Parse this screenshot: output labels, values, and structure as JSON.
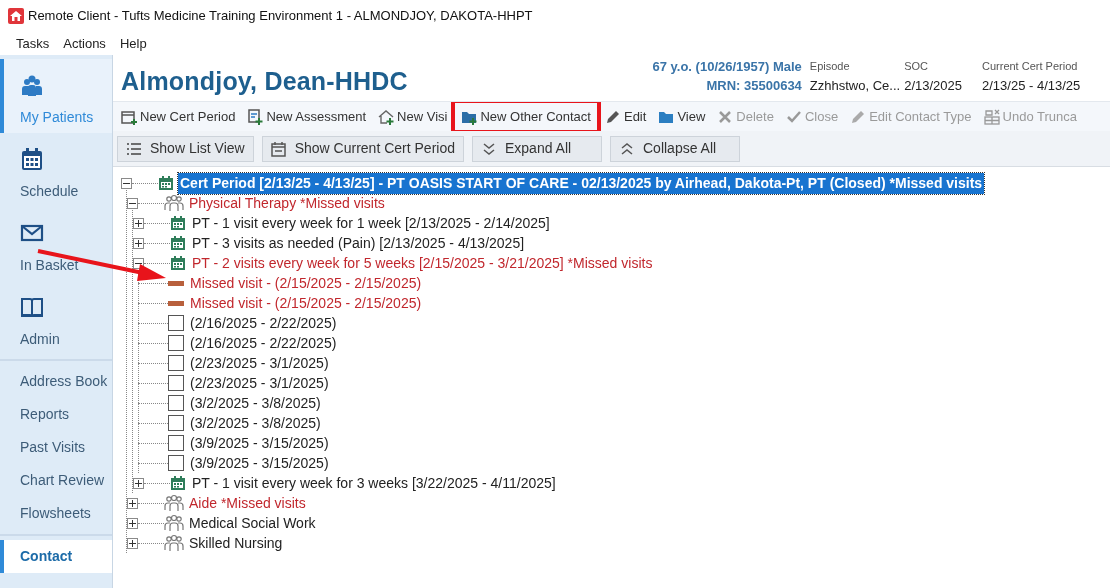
{
  "window": {
    "title": "Remote Client - Tufts Medicine Training Environment 1 - ALMONDJOY, DAKOTA-HHPT"
  },
  "menu": [
    "Tasks",
    "Actions",
    "Help"
  ],
  "sidebar": {
    "sections": [
      {
        "kind": "icon",
        "items": [
          {
            "label": "My Patients",
            "selected": true
          },
          {
            "label": "Schedule",
            "selected": false
          },
          {
            "label": "In Basket",
            "selected": false
          },
          {
            "label": "Admin",
            "selected": false
          }
        ]
      },
      {
        "kind": "text",
        "items": [
          {
            "label": "Address Book",
            "selected": false
          },
          {
            "label": "Reports",
            "selected": false
          },
          {
            "label": "Past Visits",
            "selected": false
          },
          {
            "label": "Chart Review",
            "selected": false
          },
          {
            "label": "Flowsheets",
            "selected": false
          }
        ]
      },
      {
        "kind": "text",
        "items": [
          {
            "label": "Contact",
            "selected": true
          }
        ]
      }
    ]
  },
  "patient": {
    "name": "Almondjoy, Dean-HHDC",
    "demographics": "67 y.o. (10/26/1957) Male",
    "mrn": "MRN: 35500634",
    "fields": [
      {
        "label": "Episode",
        "value": "Zzhhstwo, Ce..."
      },
      {
        "label": "SOC",
        "value": "2/13/2025"
      },
      {
        "label": "Current Cert Period",
        "value": "2/13/25 - 4/13/25"
      }
    ]
  },
  "toolbar": [
    {
      "label": "New Cert Period",
      "disabled": false,
      "highlighted": false
    },
    {
      "label": "New Assessment",
      "disabled": false,
      "highlighted": false
    },
    {
      "label": "New Visi",
      "disabled": false,
      "highlighted": false
    },
    {
      "label": "New Other Contact",
      "disabled": false,
      "highlighted": true
    },
    {
      "label": "Edit",
      "disabled": false,
      "highlighted": false
    },
    {
      "label": "View",
      "disabled": false,
      "highlighted": false
    },
    {
      "label": "Delete",
      "disabled": true,
      "highlighted": false
    },
    {
      "label": "Close",
      "disabled": true,
      "highlighted": false
    },
    {
      "label": "Edit Contact Type",
      "disabled": true,
      "highlighted": false
    },
    {
      "label": "Undo Trunca",
      "disabled": true,
      "highlighted": false
    }
  ],
  "view_buttons": [
    "Show List View",
    "Show Current Cert Period",
    "Expand All",
    "Collapse All"
  ],
  "tree": [
    {
      "kind": "period",
      "text": "Cert Period [2/13/25 - 4/13/25]  - PT OASIS START OF CARE - 02/13/2025 by Airhead, Dakota-Pt, PT (Closed) *Missed visits",
      "expanded": true,
      "selected": true,
      "children": [
        {
          "kind": "discipline",
          "text": "Physical Therapy *Missed visits",
          "expanded": true,
          "alert": true,
          "selected": false,
          "children": [
            {
              "kind": "order",
              "text": "PT - 1 visit every week for 1 week [2/13/2025 - 2/14/2025]",
              "expanded": false,
              "alert": false,
              "selected": false
            },
            {
              "kind": "order",
              "text": "PT - 3 visits as needed (Pain) [2/13/2025 - 4/13/2025]",
              "expanded": false,
              "alert": false,
              "selected": false
            },
            {
              "kind": "order",
              "text": "PT - 2 visits every week for 5 weeks [2/15/2025 - 3/21/2025] *Missed visits",
              "expanded": true,
              "alert": true,
              "selected": false,
              "children": [
                {
                  "kind": "missed",
                  "text": "Missed visit - (2/15/2025 - 2/15/2025)",
                  "alert": true,
                  "selected": false,
                  "pointed": true
                },
                {
                  "kind": "missed",
                  "text": "Missed visit - (2/15/2025 - 2/15/2025)",
                  "alert": true,
                  "selected": false,
                  "pointed": false
                },
                {
                  "kind": "visit",
                  "text": "(2/16/2025 - 2/22/2025)",
                  "alert": false,
                  "selected": false,
                  "checked": false
                },
                {
                  "kind": "visit",
                  "text": "(2/16/2025 - 2/22/2025)",
                  "alert": false,
                  "selected": false,
                  "checked": false
                },
                {
                  "kind": "visit",
                  "text": "(2/23/2025 - 3/1/2025)",
                  "alert": false,
                  "selected": false,
                  "checked": false
                },
                {
                  "kind": "visit",
                  "text": "(2/23/2025 - 3/1/2025)",
                  "alert": false,
                  "selected": false,
                  "checked": false
                },
                {
                  "kind": "visit",
                  "text": "(3/2/2025 - 3/8/2025)",
                  "alert": false,
                  "selected": false,
                  "checked": false
                },
                {
                  "kind": "visit",
                  "text": "(3/2/2025 - 3/8/2025)",
                  "alert": false,
                  "selected": false,
                  "checked": false
                },
                {
                  "kind": "visit",
                  "text": "(3/9/2025 - 3/15/2025)",
                  "alert": false,
                  "selected": false,
                  "checked": false
                },
                {
                  "kind": "visit",
                  "text": "(3/9/2025 - 3/15/2025)",
                  "alert": false,
                  "selected": false,
                  "checked": false
                }
              ]
            },
            {
              "kind": "order",
              "text": "PT - 1 visit every week for 3 weeks [3/22/2025 - 4/11/2025]",
              "expanded": false,
              "alert": false,
              "selected": false
            }
          ]
        },
        {
          "kind": "discipline",
          "text": "Aide *Missed visits",
          "expanded": false,
          "alert": true,
          "selected": false
        },
        {
          "kind": "discipline",
          "text": "Medical Social Work",
          "expanded": false,
          "alert": false,
          "selected": false
        },
        {
          "kind": "discipline",
          "text": "Skilled Nursing",
          "expanded": false,
          "alert": false,
          "selected": false
        }
      ]
    }
  ]
}
